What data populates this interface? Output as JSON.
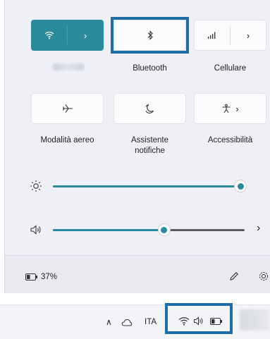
{
  "quick_settings": {
    "tiles_row1": [
      {
        "label": "",
        "icon": "wifi-icon",
        "secondary": "chevron-right-icon",
        "state": "on"
      },
      {
        "label": "Bluetooth",
        "icon": "bluetooth-icon",
        "state": "off"
      },
      {
        "label": "Cellulare",
        "icon": "cellular-signal-icon",
        "secondary": "chevron-right-icon",
        "state": "off"
      }
    ],
    "tiles_row2": [
      {
        "label": "Modalità aereo",
        "icon": "airplane-icon"
      },
      {
        "label": "Assistente notifiche",
        "label_line1": "Assistente",
        "label_line2": "notifiche",
        "icon": "moon-icon"
      },
      {
        "label": "Accessibilità",
        "icon": "accessibility-icon",
        "secondary": "chevron-right-icon"
      }
    ],
    "brightness": {
      "icon": "brightness-icon",
      "level_percent": 100
    },
    "volume": {
      "icon": "speaker-icon",
      "level_percent": 58,
      "more": "chevron-right-icon"
    }
  },
  "footer": {
    "battery_text": "37%",
    "battery_icon": "battery-icon",
    "edit_icon": "pencil-icon",
    "settings_icon": "gear-icon"
  },
  "taskbar": {
    "language": "ITA",
    "tray_overflow_icon": "chevron-up-icon",
    "cloud_icon": "cloud-icon",
    "wifi_icon": "wifi-icon",
    "volume_icon": "speaker-icon",
    "battery_icon": "battery-icon"
  },
  "colors": {
    "accent": "#2b8a9c",
    "highlight_border": "#1c6ea4",
    "panel_bg": "#eef0f5"
  }
}
